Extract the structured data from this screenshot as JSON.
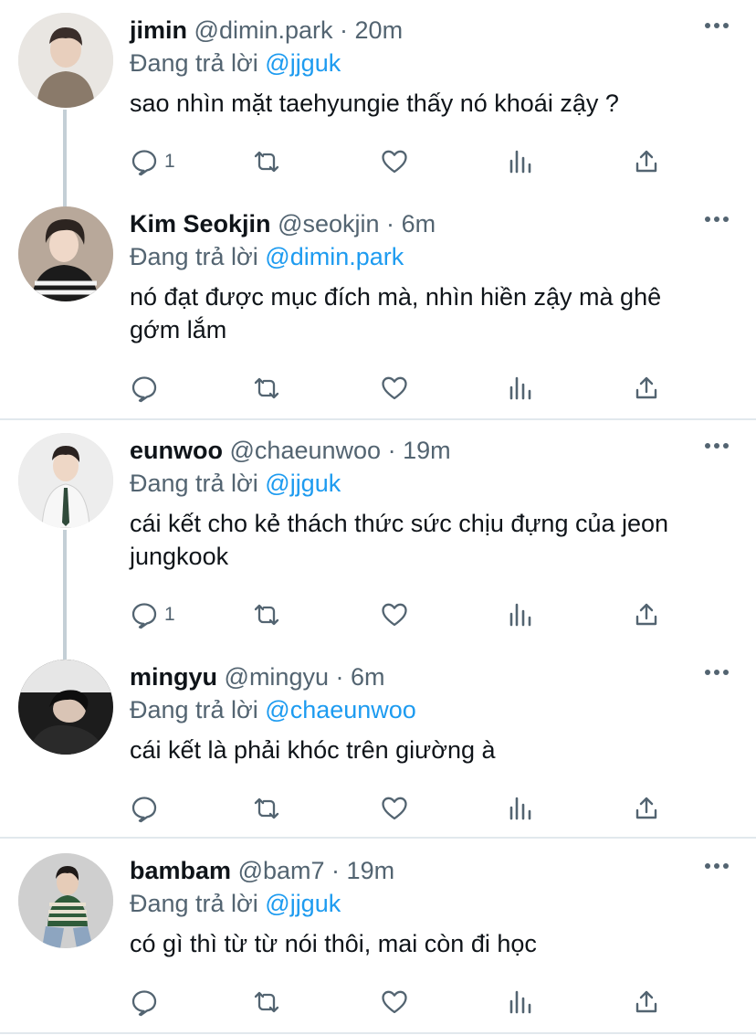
{
  "replying_prefix": "Đang trả lời",
  "dot": "·",
  "tweets": [
    {
      "name": "jimin",
      "handle": "@dimin.park",
      "time": "20m",
      "reply_to": "@jjguk",
      "text": "sao nhìn mặt taehyungie thấy nó khoái zậy ?",
      "reply_count": "1",
      "avatar_icon": "person-avatar"
    },
    {
      "name": "Kim Seokjin",
      "handle": "@seokjin",
      "time": "6m",
      "reply_to": "@dimin.park",
      "text": "nó đạt được mục đích mà, nhìn hiền zậy mà ghê gớm lắm",
      "reply_count": "",
      "avatar_icon": "person-avatar"
    },
    {
      "name": "eunwoo",
      "handle": "@chaeunwoo",
      "time": "19m",
      "reply_to": "@jjguk",
      "text": "cái kết cho kẻ thách thức sức chịu đựng của jeon jungkook",
      "reply_count": "1",
      "avatar_icon": "person-avatar"
    },
    {
      "name": "mingyu",
      "handle": "@mingyu",
      "time": "6m",
      "reply_to": "@chaeunwoo",
      "text": "cái kết là phải khóc trên giường à",
      "reply_count": "",
      "avatar_icon": "person-avatar"
    },
    {
      "name": "bambam",
      "handle": "@bam7",
      "time": "19m",
      "reply_to": "@jjguk",
      "text": "có gì thì từ từ nói thôi, mai còn đi học",
      "reply_count": "",
      "avatar_icon": "person-avatar"
    }
  ],
  "colors": {
    "link": "#1d9bf0",
    "secondary_text": "#536471",
    "thread_line": "#c4cfd6",
    "divider": "#e1e8ed"
  }
}
